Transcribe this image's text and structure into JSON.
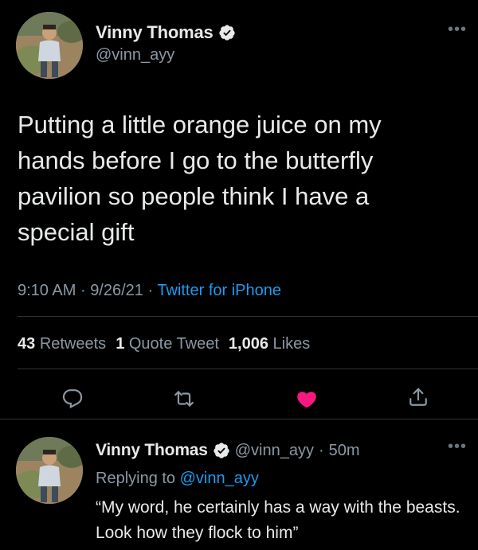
{
  "tweet": {
    "author_name": "Vinny Thomas",
    "author_handle": "@vinn_ayy",
    "text": "Putting a little orange juice on my\nhands before I go to the butterfly\npavilion so people think I have a\nspecial gift",
    "time": "9:10 AM",
    "date": "9/26/21",
    "source": "Twitter for iPhone",
    "separator": "·",
    "stats": {
      "retweets_count": "43",
      "retweets_label": "Retweets",
      "quotes_count": "1",
      "quotes_label": "Quote Tweet",
      "likes_count": "1,006",
      "likes_label": "Likes"
    },
    "more_icon": "more-icon",
    "liked": true
  },
  "reply": {
    "author_name": "Vinny Thomas",
    "author_handle": "@vinn_ayy",
    "age": "50m",
    "replying_to_label": "Replying to",
    "replying_to_handle": "@vinn_ayy",
    "text": "“My word, he certainly has a way with the beasts. Look how they flock to him”"
  },
  "colors": {
    "background": "#000000",
    "text": "#e7e9ea",
    "muted": "#8b98a5",
    "accent": "#1d9bf0",
    "like": "#f91880",
    "divider": "#2f3336"
  },
  "icons": [
    "verified-badge-icon",
    "reply-icon",
    "retweet-icon",
    "heart-icon",
    "share-icon",
    "more-icon"
  ]
}
